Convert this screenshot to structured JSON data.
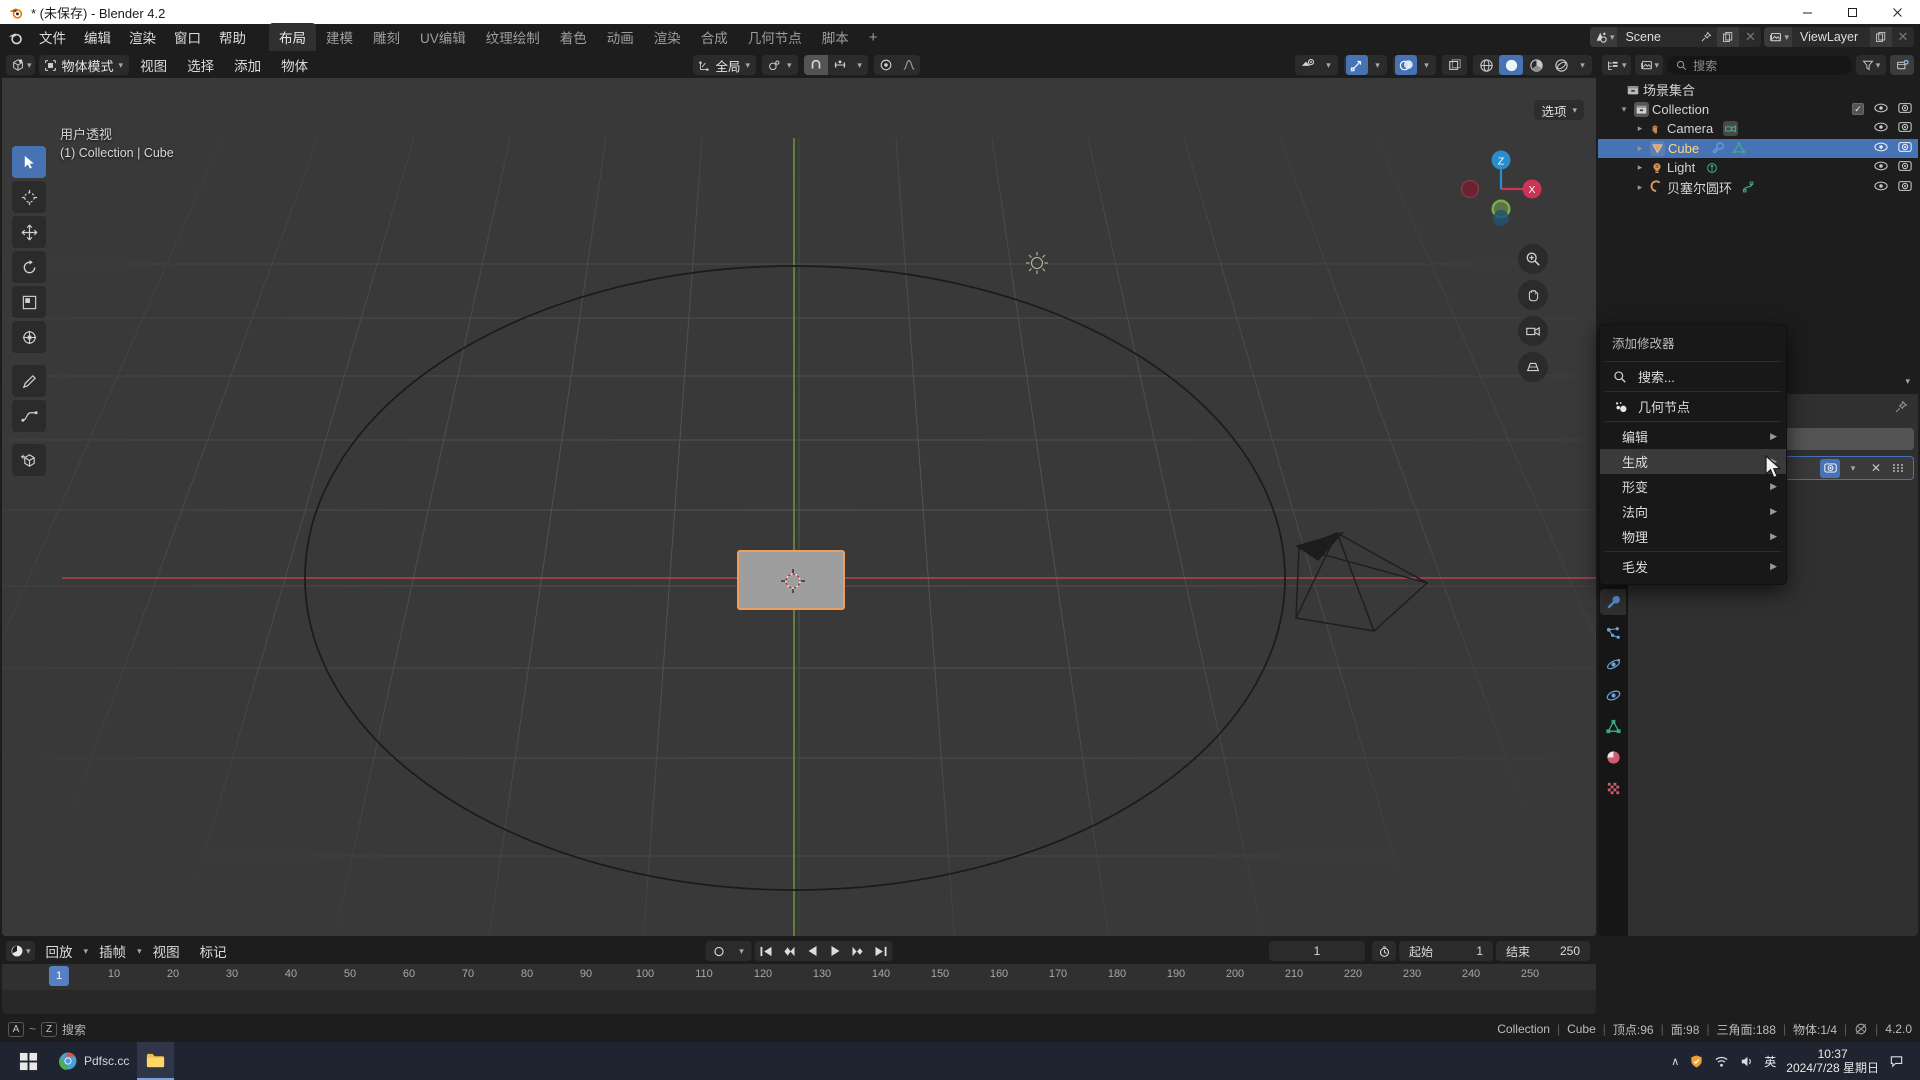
{
  "window": {
    "title": "* (未保存) - Blender 4.2",
    "minimize": "—",
    "maximize": "☐",
    "close": "✕"
  },
  "topbar": {
    "menus": [
      "文件",
      "编辑",
      "渲染",
      "窗口",
      "帮助"
    ],
    "workspaces": [
      {
        "label": "布局",
        "active": true
      },
      {
        "label": "建模",
        "active": false
      },
      {
        "label": "雕刻",
        "active": false
      },
      {
        "label": "UV编辑",
        "active": false
      },
      {
        "label": "纹理绘制",
        "active": false
      },
      {
        "label": "着色",
        "active": false
      },
      {
        "label": "动画",
        "active": false
      },
      {
        "label": "渲染",
        "active": false
      },
      {
        "label": "合成",
        "active": false
      },
      {
        "label": "几何节点",
        "active": false
      },
      {
        "label": "脚本",
        "active": false
      }
    ],
    "add_workspace": "+",
    "scene": {
      "name": "Scene",
      "icon": "scene-icon",
      "new_label": "",
      "pin": "pin-icon"
    },
    "viewlayer": {
      "name": "ViewLayer",
      "icon": "viewlayer-icon"
    }
  },
  "viewport": {
    "header": {
      "editor_type_icon": "editor-type-3dviewport-icon",
      "mode": "物体模式",
      "menus": [
        "视图",
        "选择",
        "添加",
        "物体"
      ],
      "transform_orientation": "全局",
      "snap_icon": "magnet-icon",
      "proportional_icon": "proportional-editing-icon",
      "falloff_icon": "falloff-curve-icon"
    },
    "overlay": {
      "view_name": "用户透视",
      "collection_object": "(1) Collection | Cube"
    },
    "tools": [
      "tweak-tool",
      "cursor-tool",
      "move-tool",
      "rotate-tool",
      "scale-tool",
      "transform-tool",
      "annotate-tool",
      "measure-tool",
      "add-cube-tool"
    ],
    "gizmo_axes": [
      "Z",
      "X",
      "Y"
    ],
    "shading": {
      "wireframe": "wireframe-shading",
      "solid": "solid-shading",
      "material": "material-preview-shading",
      "rendered": "rendered-shading",
      "active": "solid-shading"
    }
  },
  "outliner": {
    "display_mode": "view-layer",
    "search_placeholder": "搜索",
    "filter_icon": "filter-icon",
    "new_collection_icon": "new-collection-icon",
    "root": "场景集合",
    "items": [
      {
        "label": "Collection",
        "icon": "collection-icon",
        "depth": 0,
        "expanded": true,
        "checkbox": true,
        "eye": true,
        "camera": true,
        "selected": false,
        "extra": []
      },
      {
        "label": "Camera",
        "icon": "camera-object-icon",
        "depth": 1,
        "expanded": false,
        "checkbox": false,
        "eye": true,
        "camera": true,
        "selected": false,
        "extra": [
          "camera-data-icon"
        ]
      },
      {
        "label": "Cube",
        "icon": "mesh-object-icon",
        "depth": 1,
        "expanded": false,
        "checkbox": false,
        "eye": true,
        "camera": true,
        "selected": true,
        "extra": [
          "modifier-icon",
          "mesh-data-icon"
        ]
      },
      {
        "label": "Light",
        "icon": "light-object-icon",
        "depth": 1,
        "expanded": false,
        "checkbox": false,
        "eye": true,
        "camera": true,
        "selected": false,
        "extra": [
          "light-data-icon"
        ]
      },
      {
        "label": "贝塞尔圆环",
        "icon": "curve-object-icon",
        "depth": 1,
        "expanded": false,
        "checkbox": false,
        "eye": true,
        "camera": true,
        "selected": false,
        "extra": [
          "curve-data-icon"
        ]
      }
    ]
  },
  "properties": {
    "active_tab": "modifier-properties",
    "tabs": [
      "tool-properties",
      "render-properties",
      "output-properties",
      "view-layer-properties",
      "scene-properties",
      "world-properties",
      "collection-properties",
      "object-properties",
      "modifier-properties",
      "particle-properties",
      "physics-properties",
      "constraint-properties",
      "object-data-properties",
      "material-properties",
      "texture-properties"
    ],
    "modifier_panel": {
      "display_toggles": [
        "on-cage-icon",
        "edit-mode-icon",
        "realtime-icon",
        "render-icon"
      ],
      "dropdown": "chevron-down-icon",
      "close": "close-icon",
      "drag": "drag-dots-icon"
    }
  },
  "add_modifier_menu": {
    "title": "添加修改器",
    "search": {
      "label": "搜索...",
      "icon": "search-icon"
    },
    "geometry_nodes": {
      "label": "几何节点",
      "icon": "geometry-nodes-icon"
    },
    "categories": [
      {
        "label": "编辑",
        "highlighted": false
      },
      {
        "label": "生成",
        "highlighted": true
      },
      {
        "label": "形变",
        "highlighted": false
      },
      {
        "label": "法向",
        "highlighted": false
      },
      {
        "label": "物理",
        "highlighted": false
      }
    ],
    "hair": {
      "label": "毛发",
      "highlighted": false
    },
    "submenu_arrow": "▶"
  },
  "timeline": {
    "editor_icon": "timeline-editor-icon",
    "menus": [
      "回放",
      "插帧",
      "视图",
      "标记"
    ],
    "record_icon": "record-keyframes-icon",
    "playback_buttons": [
      "jump-to-start",
      "jump-prev-keyframe",
      "play-reverse",
      "play",
      "jump-next-keyframe",
      "jump-to-end"
    ],
    "current_frame": "1",
    "frame_icon": "auto-key-icon",
    "start_label": "起始",
    "start_value": "1",
    "end_label": "结束",
    "end_value": "250",
    "ruler_ticks": [
      "10",
      "20",
      "30",
      "40",
      "50",
      "60",
      "70",
      "80",
      "90",
      "100",
      "110",
      "120",
      "130",
      "140",
      "150",
      "160",
      "170",
      "180",
      "190",
      "200",
      "210",
      "220",
      "230",
      "240",
      "250"
    ],
    "playhead_label": "1"
  },
  "statusbar": {
    "left_keys": [
      "A",
      "Z"
    ],
    "left_label": "搜索",
    "right": {
      "collection": "Collection",
      "object": "Cube",
      "verts": "顶点:96",
      "faces": "面:98",
      "tris": "三角面:188",
      "objects": "物体:1/4",
      "memory_icon": "memory-icon",
      "version": "4.2.0"
    }
  },
  "taskbar": {
    "start_icon": "windows-start-icon",
    "items": [
      {
        "label": "Pdfsc.cc",
        "icon": "browser-icon",
        "active": false
      },
      {
        "label": "",
        "icon": "folder-icon",
        "active": true
      }
    ],
    "tray": {
      "chevron": "∧",
      "icons": [
        "shield-icon",
        "network-icon",
        "volume-icon"
      ],
      "ime": "英",
      "time": "10:37",
      "date": "2024/7/28 星期日",
      "notification": "notification-icon"
    }
  },
  "colors": {
    "accent_blue": "#4772b3",
    "selected_orange": "#ed9e5c",
    "panel_dark": "#1d1d1d",
    "viewport_bg": "#393939",
    "x_axis": "#cc3355",
    "z_axis": "#2c8ccc",
    "y_axis": "#7ab648"
  }
}
